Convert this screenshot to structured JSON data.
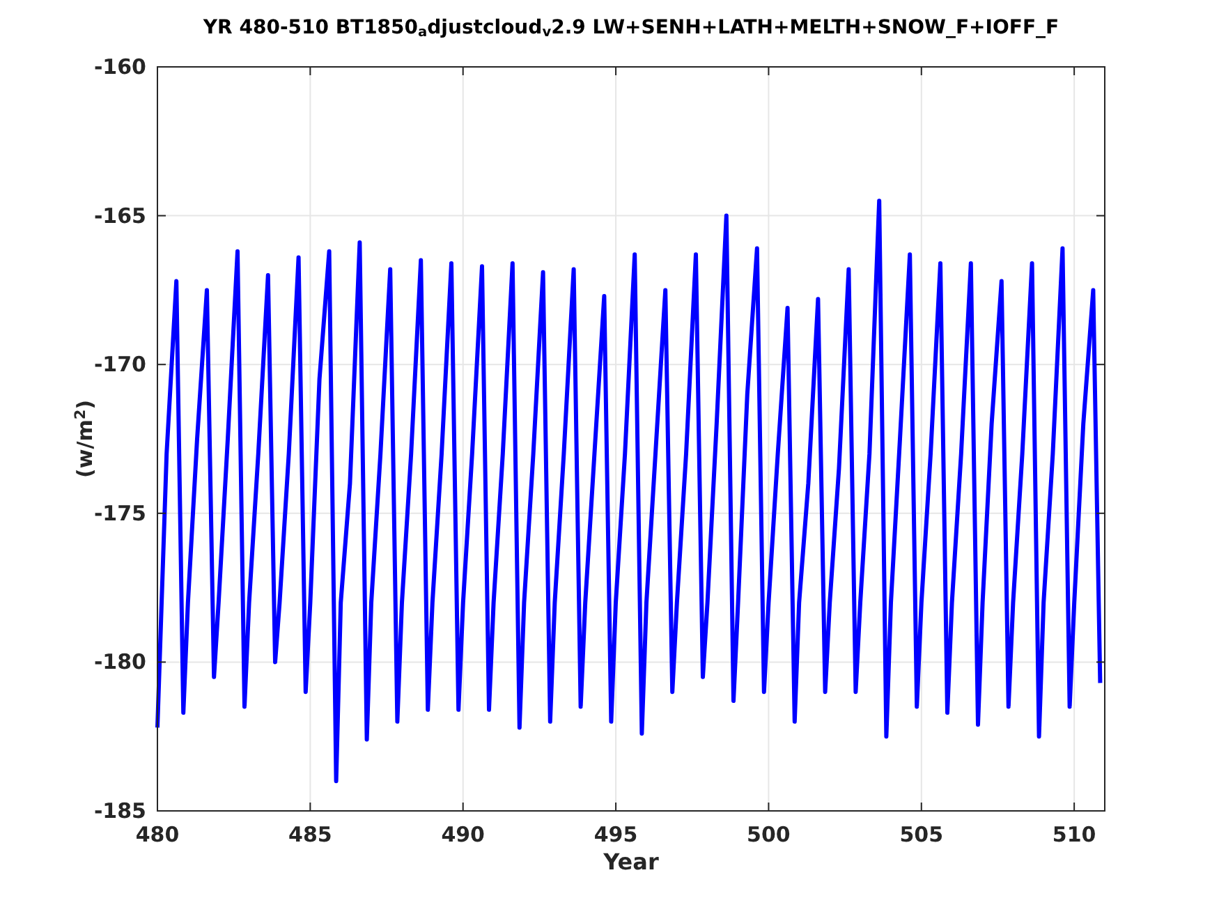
{
  "figure": {
    "chart_data": {
      "type": "line",
      "title": "YR 480-510 BT1850$_{a}$djustcloud$_{v}$2.9 LW+SENH+LATH+MELTH+SNOW_F+IOFF_F",
      "xlabel": "Year",
      "ylabel": "(w/m$^{2}$)",
      "grid": true,
      "xlim": [
        480,
        511
      ],
      "ylim": [
        -185,
        -160
      ],
      "xticks": [
        480,
        485,
        490,
        495,
        500,
        505,
        510
      ],
      "yticks": [
        -185,
        -180,
        -175,
        -170,
        -165,
        -160
      ],
      "x": [
        480,
        480.3,
        480.62,
        480.85,
        481,
        481.3,
        481.62,
        481.85,
        482,
        482.3,
        482.62,
        482.85,
        483,
        483.3,
        483.62,
        483.85,
        484,
        484.3,
        484.62,
        484.85,
        485,
        485.3,
        485.62,
        485.85,
        486,
        486.3,
        486.62,
        486.85,
        487,
        487.3,
        487.62,
        487.85,
        488,
        488.3,
        488.62,
        488.85,
        489,
        489.3,
        489.62,
        489.85,
        490,
        490.3,
        490.62,
        490.85,
        491,
        491.3,
        491.62,
        491.85,
        492,
        492.3,
        492.62,
        492.85,
        493,
        493.3,
        493.62,
        493.85,
        494,
        494.3,
        494.62,
        494.85,
        495,
        495.3,
        495.62,
        495.85,
        496,
        496.3,
        496.62,
        496.85,
        497,
        497.3,
        497.62,
        497.85,
        498,
        498.3,
        498.62,
        498.85,
        499,
        499.3,
        499.62,
        499.85,
        500,
        500.3,
        500.62,
        500.85,
        501,
        501.3,
        501.62,
        501.85,
        502,
        502.3,
        502.62,
        502.85,
        503,
        503.3,
        503.62,
        503.85,
        504,
        504.3,
        504.62,
        504.85,
        505,
        505.3,
        505.62,
        505.85,
        506,
        506.3,
        506.62,
        506.85,
        507,
        507.3,
        507.62,
        507.85,
        508,
        508.3,
        508.62,
        508.85,
        509,
        509.3,
        509.62,
        509.85,
        510,
        510.3,
        510.62,
        510.85
      ],
      "series": [
        {
          "color": "#0000ff",
          "values": [
            -182.2,
            -173,
            -167.2,
            -181.7,
            -178,
            -172.5,
            -167.5,
            -180.5,
            -178,
            -172.5,
            -166.2,
            -181.5,
            -178,
            -173,
            -167,
            -180,
            -178,
            -173,
            -166.4,
            -181,
            -178,
            -170.5,
            -166.2,
            -184,
            -178,
            -174,
            -165.9,
            -182.6,
            -178,
            -173,
            -166.8,
            -182,
            -178,
            -173,
            -166.5,
            -181.6,
            -178,
            -173,
            -166.6,
            -181.6,
            -178,
            -173,
            -166.7,
            -181.6,
            -178,
            -173,
            -166.6,
            -182.2,
            -178,
            -173,
            -166.9,
            -182,
            -178,
            -173,
            -166.8,
            -181.5,
            -178,
            -173,
            -167.7,
            -182,
            -178,
            -173,
            -166.3,
            -182.4,
            -178,
            -173,
            -167.5,
            -181,
            -178,
            -173,
            -166.3,
            -180.5,
            -178,
            -172,
            -165,
            -181.3,
            -178,
            -171,
            -166.1,
            -181,
            -178,
            -173,
            -168.1,
            -182,
            -178,
            -174,
            -167.8,
            -181,
            -178,
            -173.5,
            -166.8,
            -181,
            -178,
            -173,
            -164.5,
            -182.5,
            -178,
            -172.5,
            -166.3,
            -181.5,
            -178,
            -173,
            -166.6,
            -181.7,
            -178,
            -173,
            -166.6,
            -182.1,
            -178,
            -172,
            -167.2,
            -181.5,
            -178,
            -173,
            -166.6,
            -182.5,
            -178,
            -173,
            -166.1,
            -181.5,
            -178,
            -172,
            -167.5,
            -180.7
          ]
        }
      ]
    }
  }
}
